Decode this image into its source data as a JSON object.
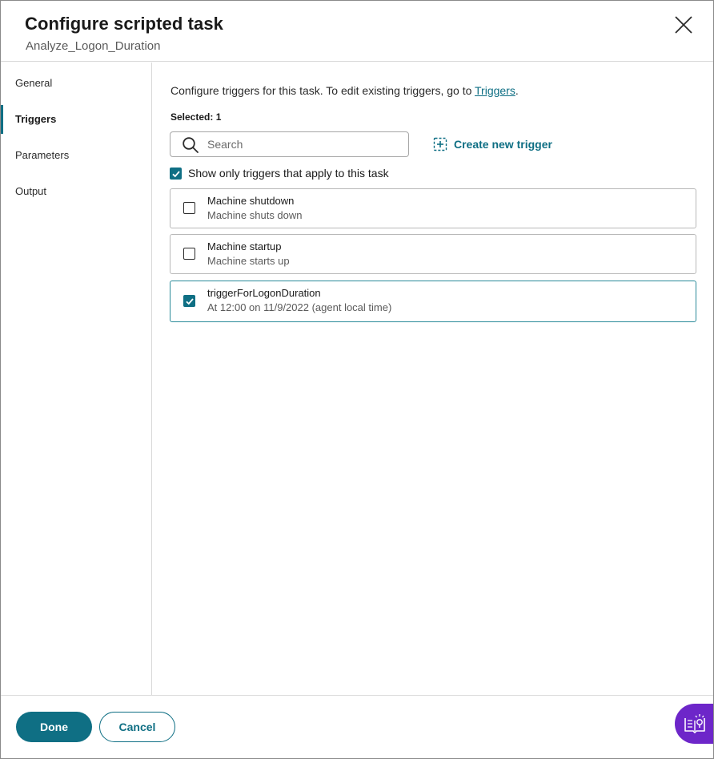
{
  "dialog": {
    "title": "Configure scripted task",
    "subtitle": "Analyze_Logon_Duration"
  },
  "sidebar": {
    "items": [
      {
        "label": "General",
        "active": false
      },
      {
        "label": "Triggers",
        "active": true
      },
      {
        "label": "Parameters",
        "active": false
      },
      {
        "label": "Output",
        "active": false
      }
    ]
  },
  "main": {
    "intro_text": "Configure triggers for this task. To edit existing triggers, go to ",
    "intro_link": "Triggers",
    "intro_end": ".",
    "selected_text": "Selected: 1",
    "search": {
      "placeholder": "Search",
      "value": ""
    },
    "create_label": "Create new trigger",
    "filter": {
      "label": "Show only triggers that apply to this task",
      "checked": true
    },
    "triggers": [
      {
        "name": "Machine shutdown",
        "description": "Machine shuts down",
        "checked": false
      },
      {
        "name": "Machine startup",
        "description": "Machine starts up",
        "checked": false
      },
      {
        "name": "triggerForLogonDuration",
        "description": "At 12:00 on 11/9/2022 (agent local time)",
        "checked": true
      }
    ]
  },
  "footer": {
    "done_label": "Done",
    "cancel_label": "Cancel"
  },
  "colors": {
    "accent": "#0f6f84",
    "help_fab": "#6d26c9"
  },
  "icons": {
    "close": "close-icon",
    "search": "search-icon",
    "create": "add-box-icon",
    "help": "help-book-icon"
  }
}
